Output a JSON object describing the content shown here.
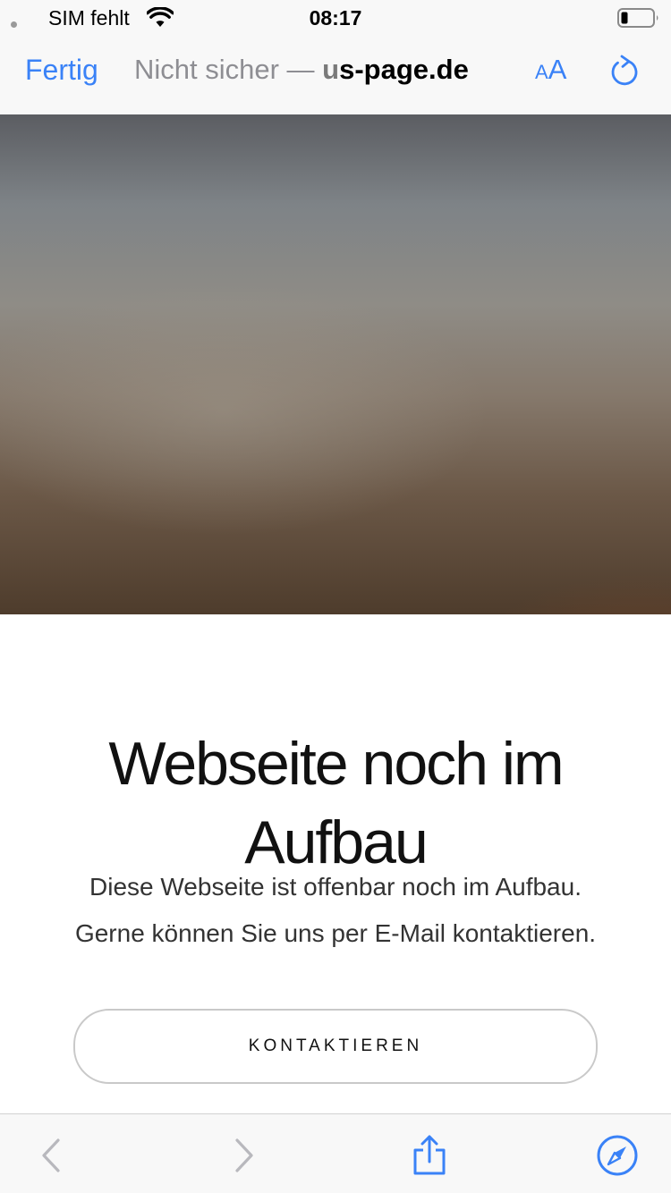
{
  "status_bar": {
    "carrier": "SIM fehlt",
    "time": "08:17",
    "icons": [
      "signal-dot-icon",
      "wifi-icon",
      "battery-icon"
    ]
  },
  "browser": {
    "done_label": "Fertig",
    "url_insecure": "Nicht sicher — ",
    "url_domain_prefix": "u",
    "url_domain": "s-page.de",
    "text_size_small": "A",
    "text_size_big": "A",
    "icons": {
      "reload": "reload-icon"
    }
  },
  "page": {
    "title": "Webseite noch im Aufbau",
    "description_line1": "Diese Webseite ist offenbar noch im Aufbau.",
    "description_line2": "Gerne können Sie uns per E-Mail kontaktieren.",
    "contact_button_label": "KONTAKTIEREN"
  },
  "toolbar": {
    "icons": [
      "back-icon",
      "forward-icon",
      "share-icon",
      "compass-icon"
    ]
  },
  "colors": {
    "accent": "#3a82f7",
    "bar_background": "#f8f8f8",
    "disabled": "#b8b8bd"
  }
}
